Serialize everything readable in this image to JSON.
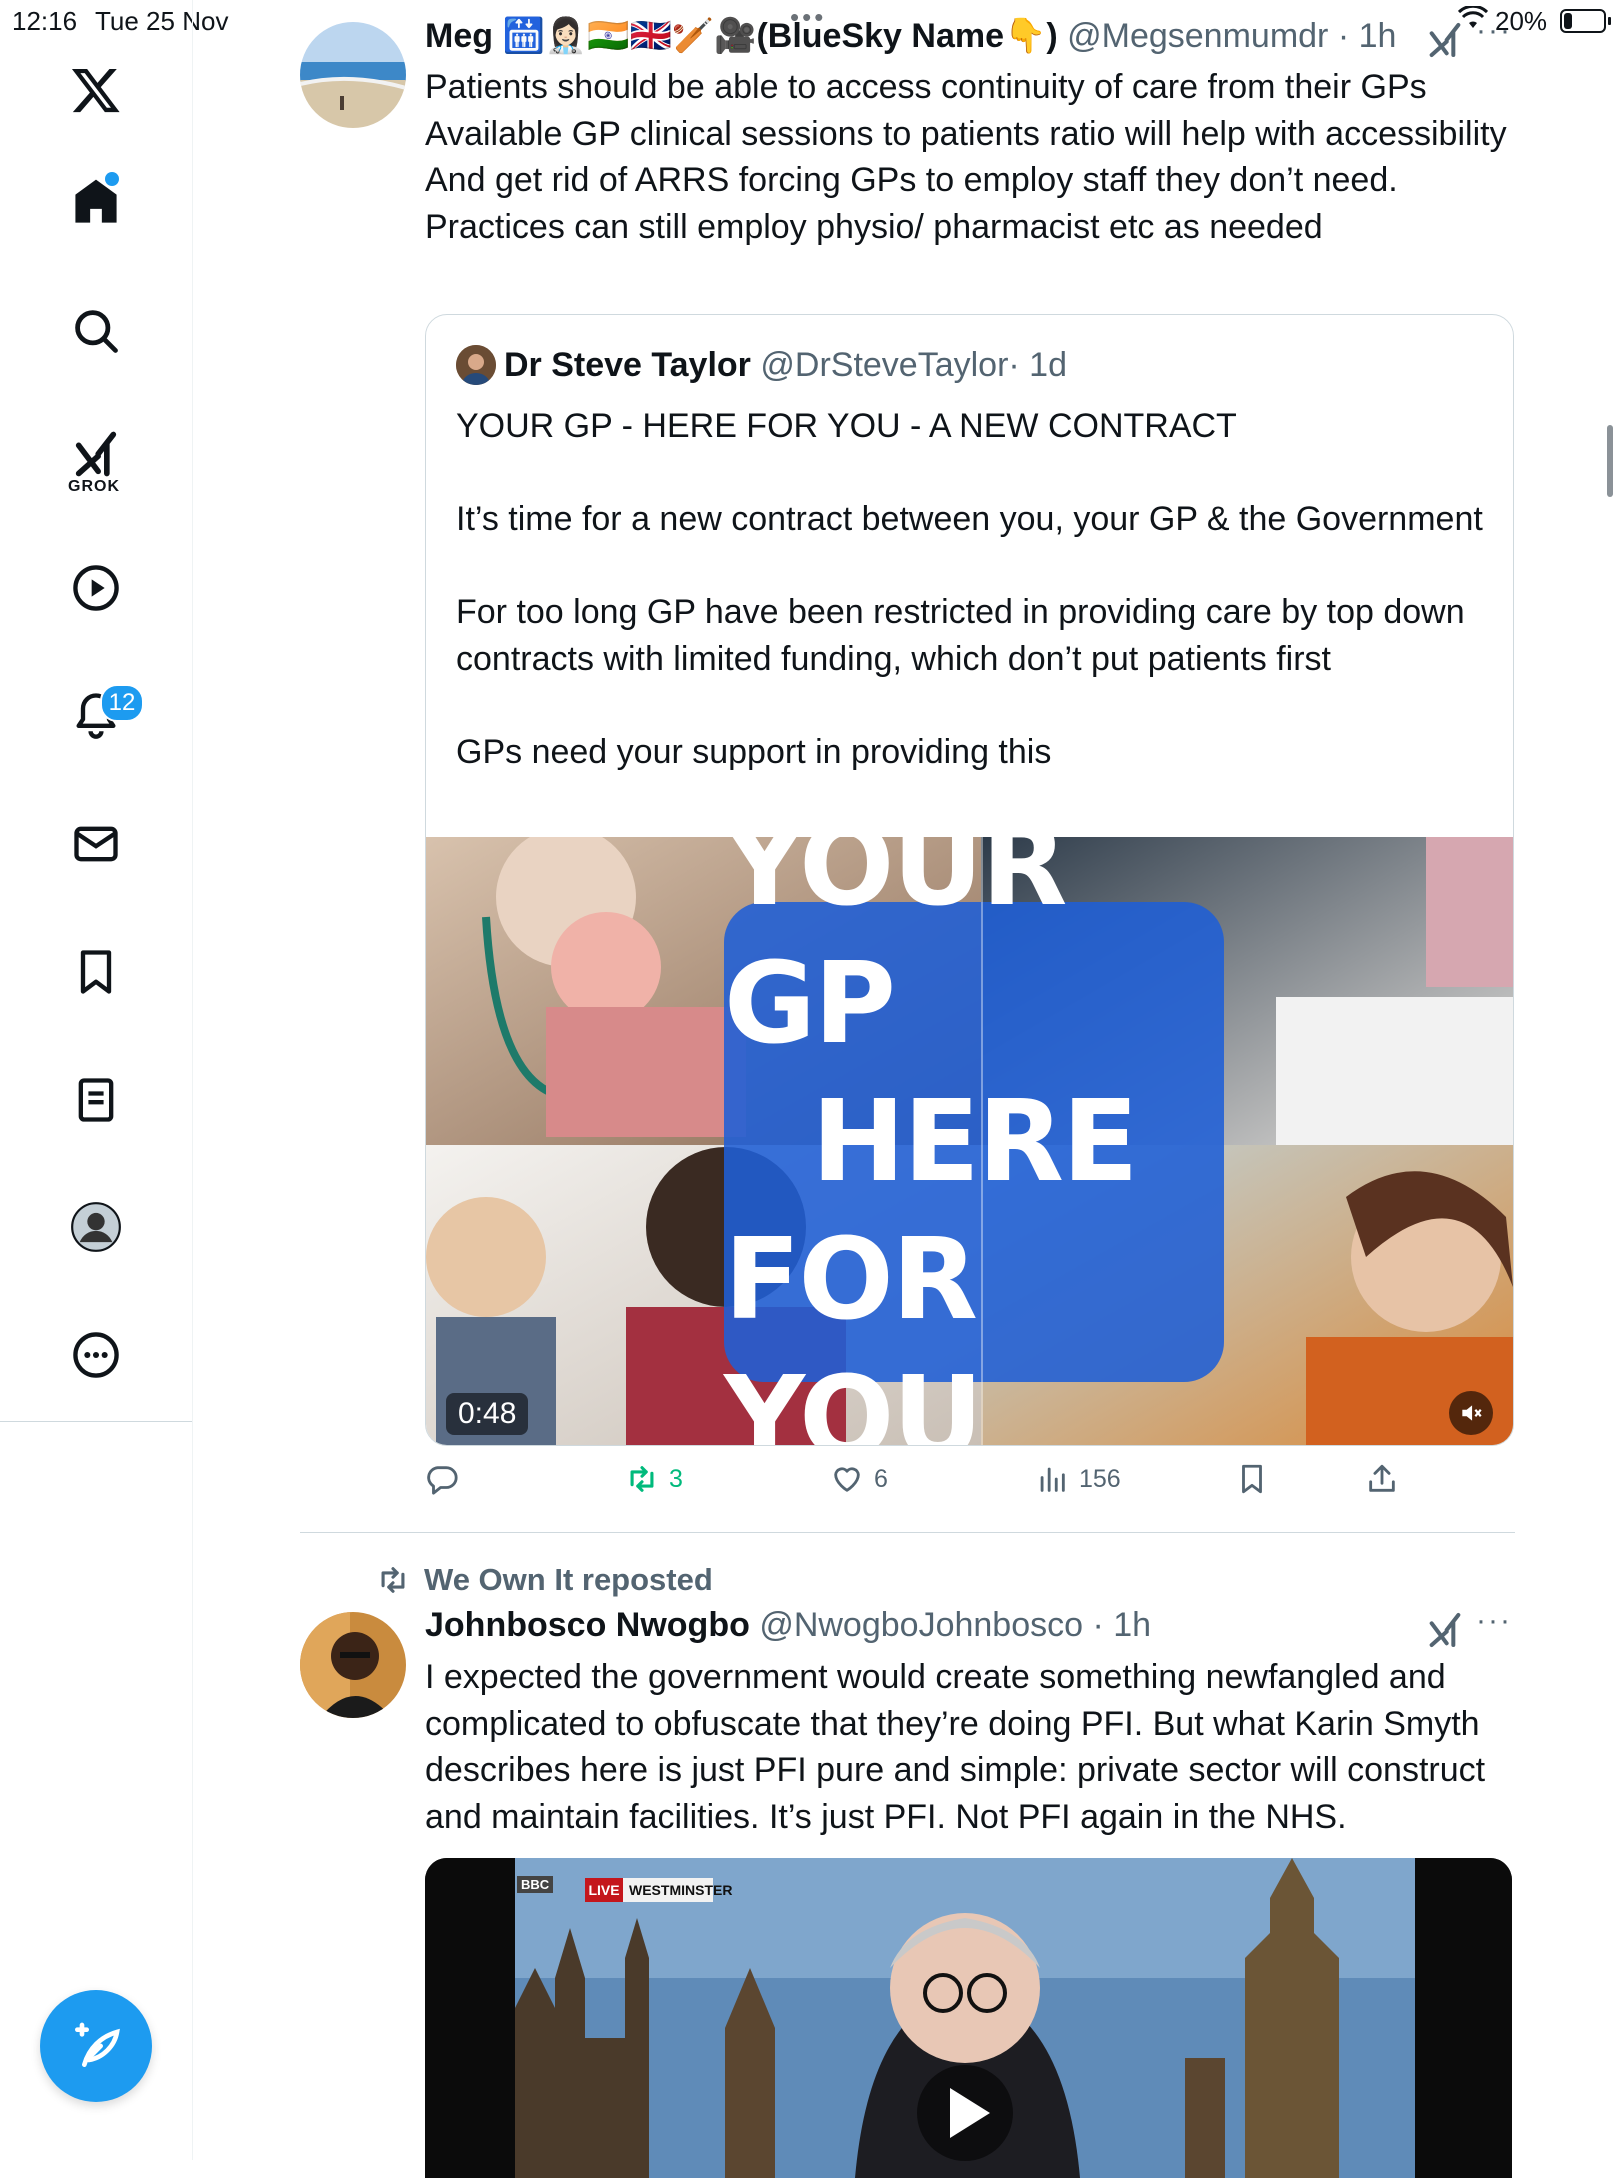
{
  "status_bar": {
    "time": "12:16",
    "date": "Tue 25 Nov",
    "battery": "20%",
    "battery_level": 0.2
  },
  "sidebar": {
    "notifications_count": "12",
    "grok_label": "GROK",
    "items": [
      "x-logo",
      "home-icon",
      "search-icon",
      "grok-icon",
      "video-icon",
      "bell-icon",
      "mail-icon",
      "bookmark-icon",
      "lists-icon",
      "profile-icon",
      "more-icon"
    ]
  },
  "tweet1": {
    "name": "Meg 🛗👩🏻‍⚕️🇮🇳🇬🇧🏏🎥(BlueSky Name👇)",
    "handle": "@Megsenmumdr",
    "time": "· 1h",
    "text": "Patients should be able to access continuity of care from their GPs\nAvailable GP clinical sessions to patients ratio will help with accessibility\nAnd get rid of ARRS forcing GPs to employ staff they don’t need.\nPractices can still employ physio/ pharmacist etc as needed",
    "quote": {
      "name": "Dr Steve Taylor",
      "handle": "@DrSteveTaylor",
      "time": "· 1d",
      "text": "YOUR GP - HERE FOR YOU - A NEW CONTRACT\n\nIt’s time for a new contract between you, your GP & the Government\n\nFor too long GP have been restricted in providing care by top down contracts with limited funding, which don’t put patients first\n\nGPs need your support in providing this",
      "video_title_lines": [
        "YOUR GP",
        "HERE",
        "FOR YOU"
      ],
      "video_duration": "0:48"
    },
    "actions": {
      "retweets": "3",
      "likes": "6",
      "views": "156"
    }
  },
  "tweet2": {
    "repost_by": "We Own It reposted",
    "name": "Johnbosco Nwogbo",
    "handle": "@NwogboJohnbosco",
    "time": "· 1h",
    "text": "I expected the government would create something newfangled and complicated to obfuscate that they’re doing PFI. But what Karin Smyth describes here is just PFI pure and simple: private sector will construct and maintain facilities. It’s just PFI. Not PFI again in the NHS.",
    "video_channel": "BBC",
    "video_live": "LIVE",
    "video_location": "WESTMINSTER"
  },
  "colors": {
    "accent": "#1d9bf0",
    "retweet_active": "#00ba7c",
    "secondary_text": "#536471"
  }
}
